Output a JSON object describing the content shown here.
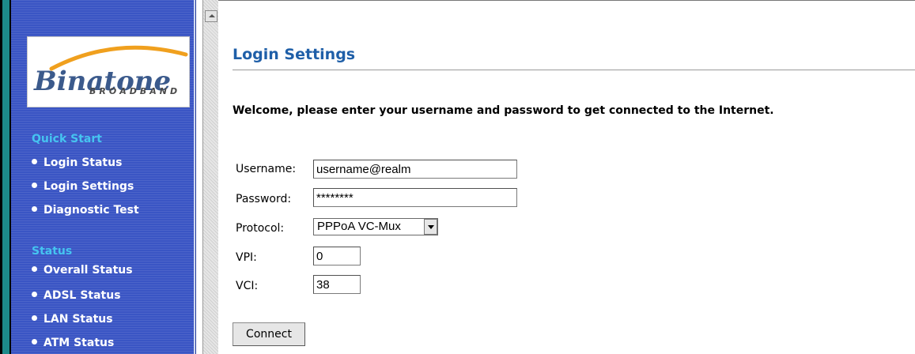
{
  "sidebar": {
    "logo": {
      "brand": "Binatone",
      "tagline": "BROADBAND"
    },
    "sections": [
      {
        "title": "Quick Start",
        "items": [
          {
            "label": "Login Status"
          },
          {
            "label": "Login Settings"
          },
          {
            "label": "Diagnostic Test"
          }
        ]
      },
      {
        "title": "Status",
        "items": [
          {
            "label": "Overall Status"
          },
          {
            "label": "ADSL Status"
          },
          {
            "label": "LAN Status"
          },
          {
            "label": "ATM Status"
          }
        ]
      }
    ]
  },
  "main": {
    "title": "Login Settings",
    "welcome": "Welcome, please enter your username and password to get connected to the Internet.",
    "form": {
      "username": {
        "label": "Username:",
        "value": "username@realm"
      },
      "password": {
        "label": "Password:",
        "value": "********"
      },
      "protocol": {
        "label": "Protocol:",
        "value": "PPPoA VC-Mux"
      },
      "vpi": {
        "label": "VPI:",
        "value": "0"
      },
      "vci": {
        "label": "VCI:",
        "value": "38"
      }
    },
    "connect_label": "Connect"
  },
  "colors": {
    "sidebar_bg": "#3a55c4",
    "section_title": "#45c4f0",
    "page_title": "#1f5fa8"
  }
}
